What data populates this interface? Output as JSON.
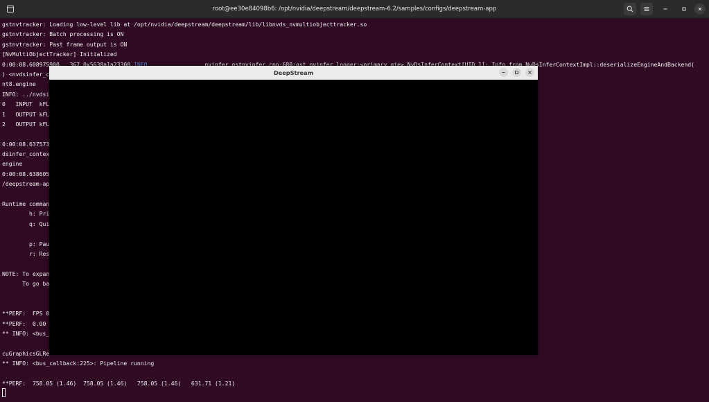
{
  "terminal": {
    "title": "root@ee30e84098b6: /opt/nvidia/deepstream/deepstream-6.2/samples/configs/deepstream-app",
    "lines": [
      {
        "text": "gstnvtracker: Loading low-level lib at /opt/nvidia/deepstream/deepstream/lib/libnvds_nvmultiobjecttracker.so"
      },
      {
        "text": "gstnvtracker: Batch processing is ON"
      },
      {
        "text": "gstnvtracker: Past frame output is ON"
      },
      {
        "text": "[NvMultiObjectTracker] Initialized"
      },
      {
        "text": "0:00:08.608975900   367 0x5638a1a23300 ",
        "info": "INFO",
        "rest": "                 nvinfer gstnvinfer.cpp:680:gst_nvinfer_logger:<primary_gie> NvDsInferContext[UID 1]: Info from NvDsInferContextImpl::deserializeEngineAndBackend("
      },
      {
        "text": ") <nvdsinfer_c                                                                                              ls/Primary_Detector/resnet10.caffemodel_b4_gpu0_i"
      },
      {
        "text": "nt8.engine"
      },
      {
        "text": "INFO: ../nvdsi"
      },
      {
        "text": "0   INPUT  kFL"
      },
      {
        "text": "1   OUTPUT kFL"
      },
      {
        "text": "2   OUTPUT kFL"
      },
      {
        "text": ""
      },
      {
        "text": "0:00:08.637573                                                                                              vDsInferContextImpl::generateBackendContext() <nv"
      },
      {
        "text": "dsinfer_contex                                                                                              rimary_Detector/resnet10.caffemodel_b4_gpu0_int8."
      },
      {
        "text": "engine"
      },
      {
        "text": "0:00:08.638605                                                                                              /nvidia/deepstream/deepstream-6.2/samples/configs"
      },
      {
        "text": "/deepstream-ap"
      },
      {
        "text": ""
      },
      {
        "text": "Runtime comman"
      },
      {
        "text": "        h: Pri"
      },
      {
        "text": "        q: Qui"
      },
      {
        "text": ""
      },
      {
        "text": "        p: Pau"
      },
      {
        "text": "        r: Res"
      },
      {
        "text": ""
      },
      {
        "text": "NOTE: To expan"
      },
      {
        "text": "      To go ba"
      },
      {
        "text": ""
      },
      {
        "text": ""
      },
      {
        "text": "**PERF:  FPS 0"
      },
      {
        "text": "**PERF:  0.00 "
      },
      {
        "text": "** INFO: <bus_"
      },
      {
        "text": ""
      },
      {
        "text": "cuGraphicsGLRe"
      },
      {
        "text": "** INFO: <bus_callback:225>: Pipeline running"
      },
      {
        "text": ""
      },
      {
        "text": "**PERF:  758.05 (1.46)  758.05 (1.46)   758.05 (1.46)   631.71 (1.21)"
      }
    ]
  },
  "window": {
    "title": "DeepStream"
  }
}
